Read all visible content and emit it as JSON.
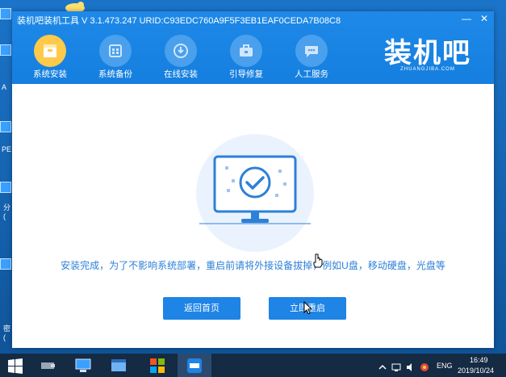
{
  "window": {
    "title": "装机吧装机工具 V 3.1.473.247 URID:C93EDC760A9F5F3EB1EAF0CEDA7B08C8",
    "minimize_glyph": "—",
    "close_glyph": "✕"
  },
  "nav": {
    "items": [
      {
        "label": "系统安装",
        "icon": "box-icon",
        "active": true
      },
      {
        "label": "系统备份",
        "icon": "windows-backup-icon",
        "active": false
      },
      {
        "label": "在线安装",
        "icon": "download-icon",
        "active": false
      },
      {
        "label": "引导修复",
        "icon": "briefcase-icon",
        "active": false
      },
      {
        "label": "人工服务",
        "icon": "chat-icon",
        "active": false
      }
    ]
  },
  "brand": {
    "name": "装机吧",
    "url": "ZHUANGJIBA.COM"
  },
  "main": {
    "message": "安装完成，为了不影响系统部署，重启前请将外接设备拔掉，例如U盘，移动硬盘，光盘等",
    "back_button": "返回首页",
    "restart_button": "立即重启"
  },
  "desktop": {
    "side_labels": [
      "A",
      "PE",
      "分",
      "(",
      "密",
      "("
    ]
  },
  "taskbar": {
    "lang": "ENG",
    "time": "16:49",
    "date": "2019/10/24"
  },
  "colors": {
    "titlebar": "#157fdf",
    "accent": "#1e84e5",
    "active_nav": "#ffc94a",
    "message": "#2d80d8"
  }
}
